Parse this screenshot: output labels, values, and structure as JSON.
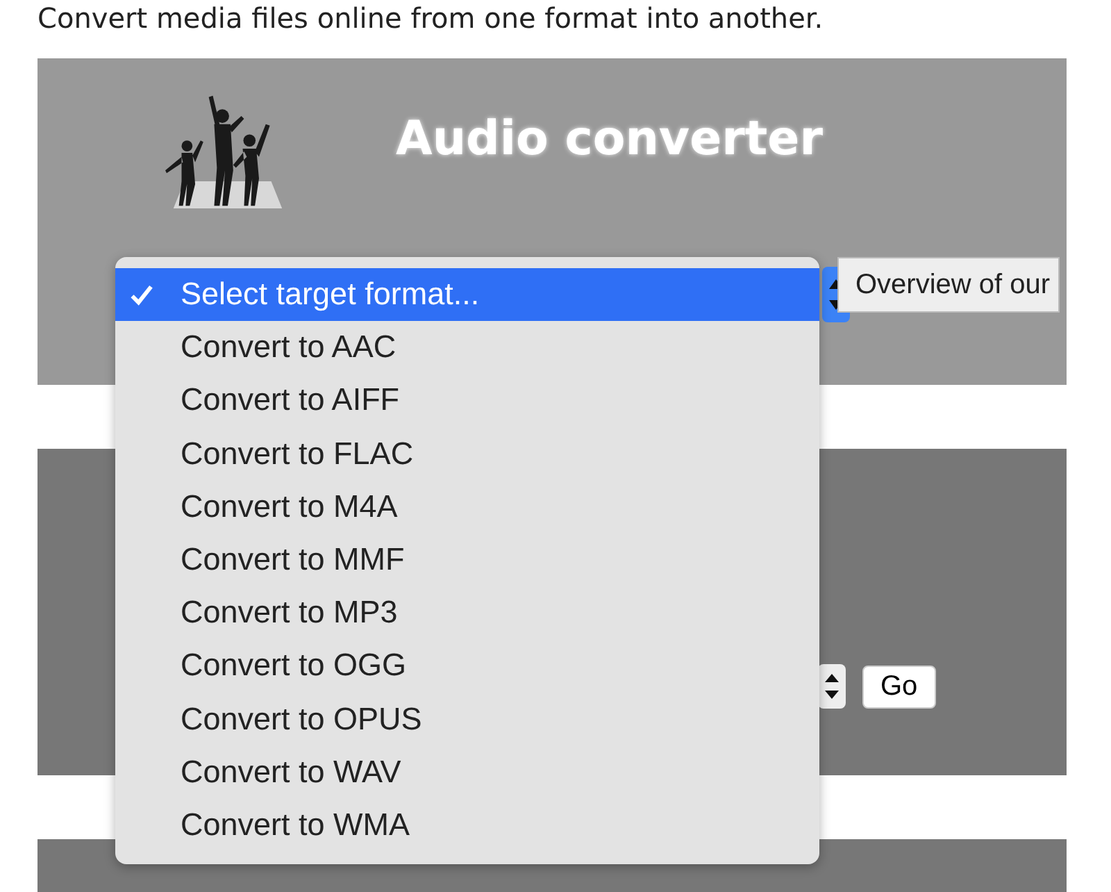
{
  "intro": "Convert media files online from one format into another.",
  "audio_panel": {
    "title": "Audio converter"
  },
  "second_panel": {
    "button": "Go"
  },
  "dropdown": {
    "options": [
      {
        "label": "Select target format...",
        "selected": true
      },
      {
        "label": "Convert to AAC",
        "selected": false
      },
      {
        "label": "Convert to AIFF",
        "selected": false
      },
      {
        "label": "Convert to FLAC",
        "selected": false
      },
      {
        "label": "Convert to M4A",
        "selected": false
      },
      {
        "label": "Convert to MMF",
        "selected": false
      },
      {
        "label": "Convert to MP3",
        "selected": false
      },
      {
        "label": "Convert to OGG",
        "selected": false
      },
      {
        "label": "Convert to OPUS",
        "selected": false
      },
      {
        "label": "Convert to WAV",
        "selected": false
      },
      {
        "label": "Convert to WMA",
        "selected": false
      }
    ]
  },
  "tooltip": "Overview of our"
}
